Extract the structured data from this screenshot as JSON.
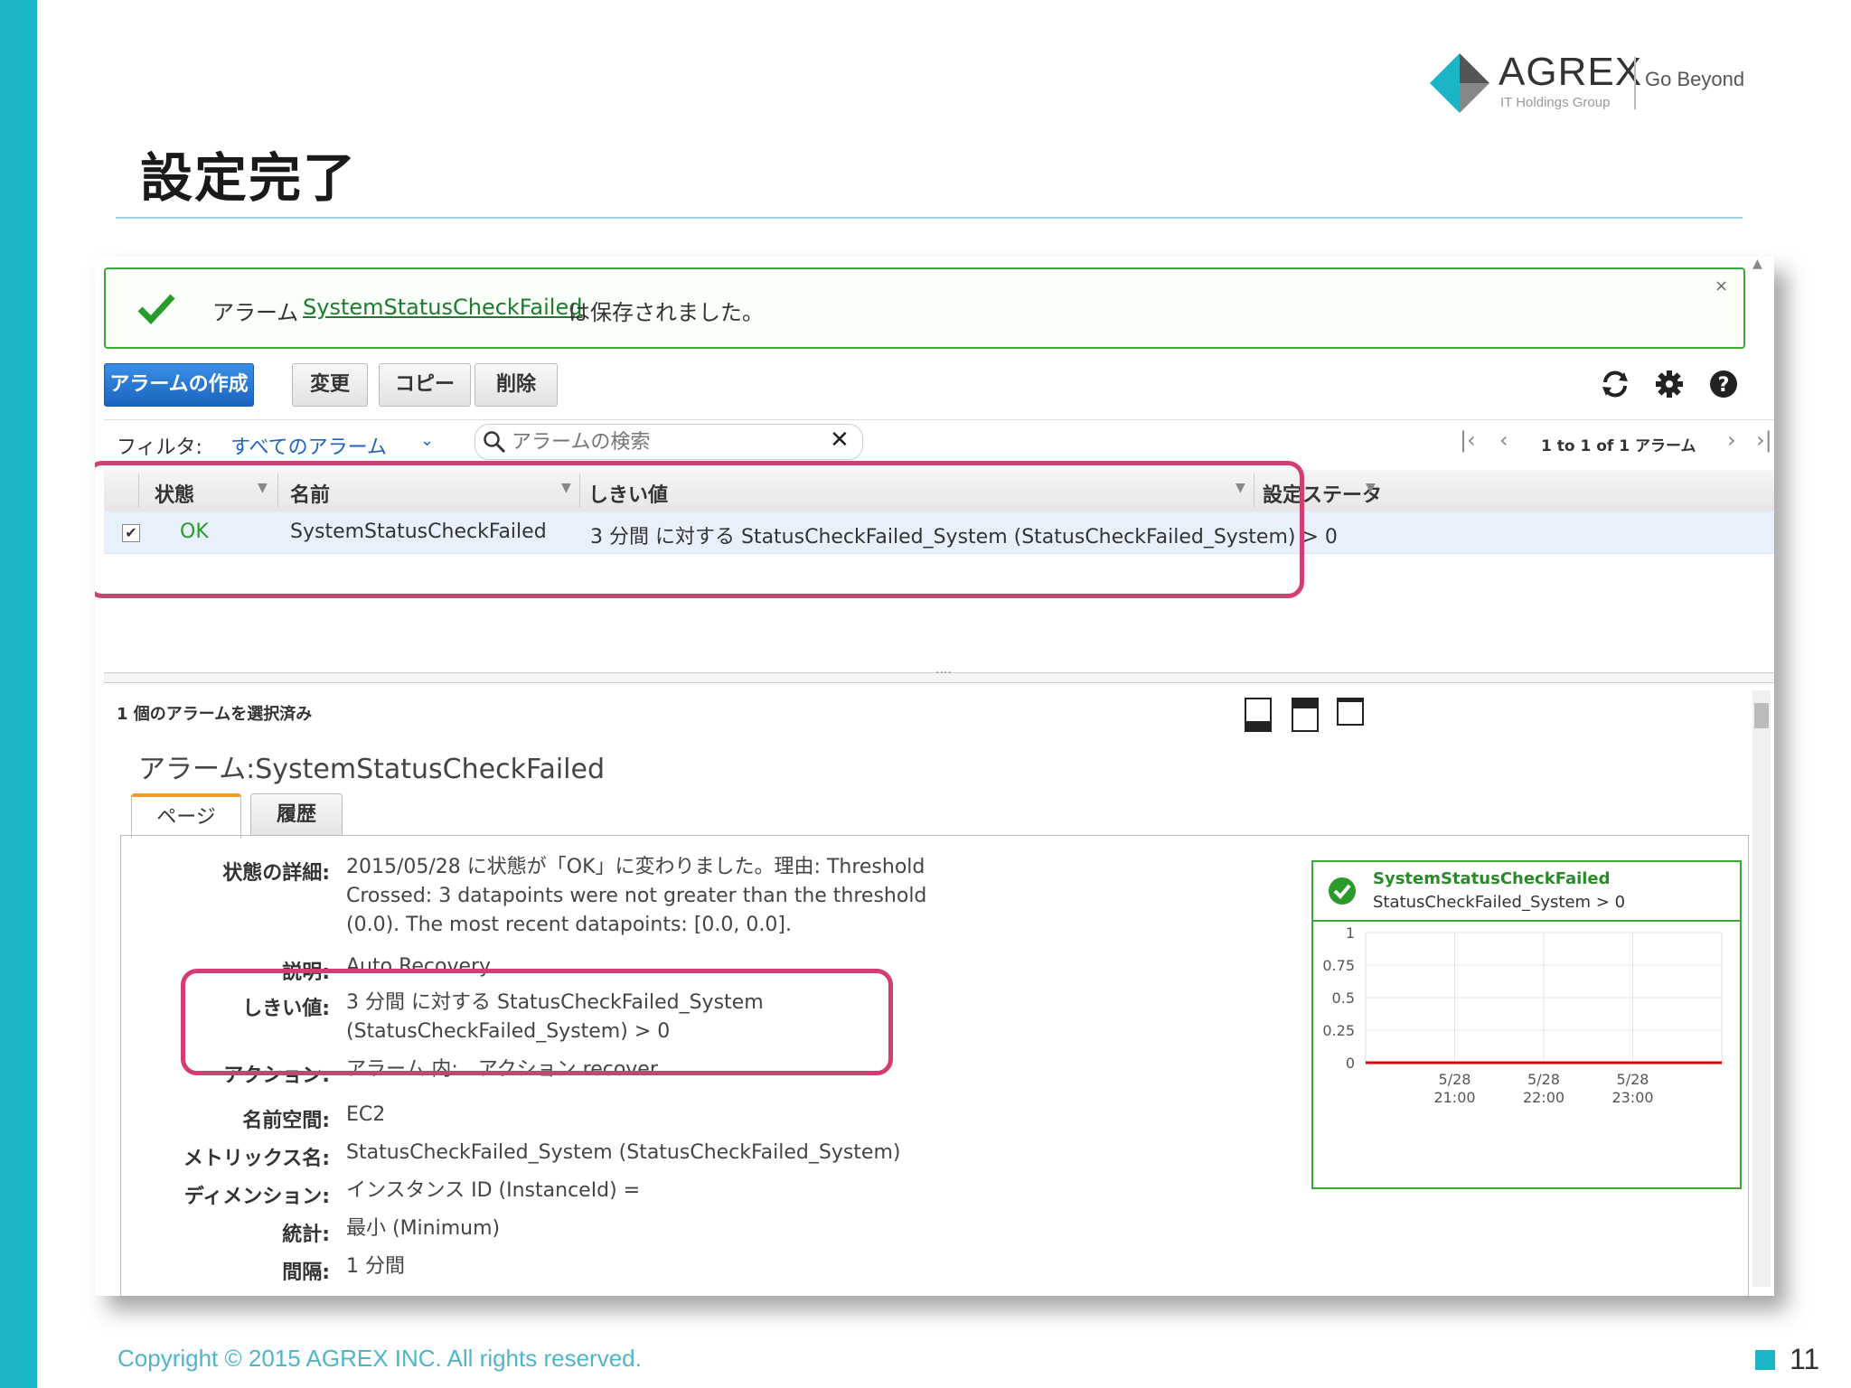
{
  "slide": {
    "title": "設定完了",
    "logo_name": "AGREX",
    "logo_group": "IT Holdings Group",
    "logo_tagline": "Go Beyond",
    "copyright": "Copyright © 2015 AGREX INC. All rights reserved.",
    "page_number": "11",
    "accent": "#1cb5c8"
  },
  "notice": {
    "prefix": "アラーム",
    "alarm_link": "SystemStatusCheckFailed",
    "suffix": "は保存されました。",
    "close": "×"
  },
  "toolbar": {
    "create": "アラームの作成",
    "modify": "変更",
    "copy": "コピー",
    "delete": "削除",
    "icons": [
      "refresh-icon",
      "gear-icon",
      "help-icon"
    ]
  },
  "filter": {
    "label": "フィルタ:",
    "value": "すべてのアラーム",
    "search_placeholder": "アラームの検索",
    "pager_text": "1 to 1 of 1 アラーム"
  },
  "table": {
    "columns": [
      "状態",
      "名前",
      "しきい値",
      "設定ステータ"
    ],
    "row": {
      "checked": "✔",
      "state": "OK",
      "name": "SystemStatusCheckFailed",
      "threshold": "3 分間 に対する StatusCheckFailed_System (StatusCheckFailed_System) > 0"
    }
  },
  "details": {
    "selected_count": "1 個のアラームを選択済み",
    "title": "アラーム:SystemStatusCheckFailed",
    "tabs": [
      "ページ",
      "履歴"
    ],
    "fields": [
      {
        "label": "状態の詳細:",
        "lines": [
          "2015/05/28 に状態が「OK」に変わりました。理由: Threshold",
          "Crossed: 3 datapoints were not greater than the threshold",
          "(0.0). The most recent datapoints: [0.0, 0.0]."
        ]
      },
      {
        "label": "説明:",
        "lines": [
          "Auto Recovery"
        ]
      },
      {
        "label": "しきい値:",
        "lines": [
          "3 分間 に対する StatusCheckFailed_System",
          "(StatusCheckFailed_System) > 0"
        ]
      },
      {
        "label": "アクション:",
        "lines": [
          "アラーム 内:　アクション recover"
        ]
      },
      {
        "label": "名前空間:",
        "lines": [
          "EC2"
        ]
      },
      {
        "label": "メトリックス名:",
        "lines": [
          "StatusCheckFailed_System (StatusCheckFailed_System)"
        ]
      },
      {
        "label": "ディメンション:",
        "lines": [
          "インスタンス ID (InstanceId) ="
        ]
      },
      {
        "label": "統計:",
        "lines": [
          "最小 (Minimum)"
        ]
      },
      {
        "label": "間隔:",
        "lines": [
          "1 分間"
        ]
      }
    ]
  },
  "chart_data": {
    "type": "line",
    "title": "SystemStatusCheckFailed",
    "subtitle": "StatusCheckFailed_System > 0",
    "y_ticks": [
      "1",
      "0.75",
      "0.5",
      "0.25",
      "0"
    ],
    "ylim": [
      0,
      1
    ],
    "x_ticks": [
      [
        "5/28",
        "21:00"
      ],
      [
        "5/28",
        "22:00"
      ],
      [
        "5/28",
        "23:00"
      ]
    ],
    "threshold": 0,
    "threshold_color": "#e00000",
    "grid": true
  }
}
